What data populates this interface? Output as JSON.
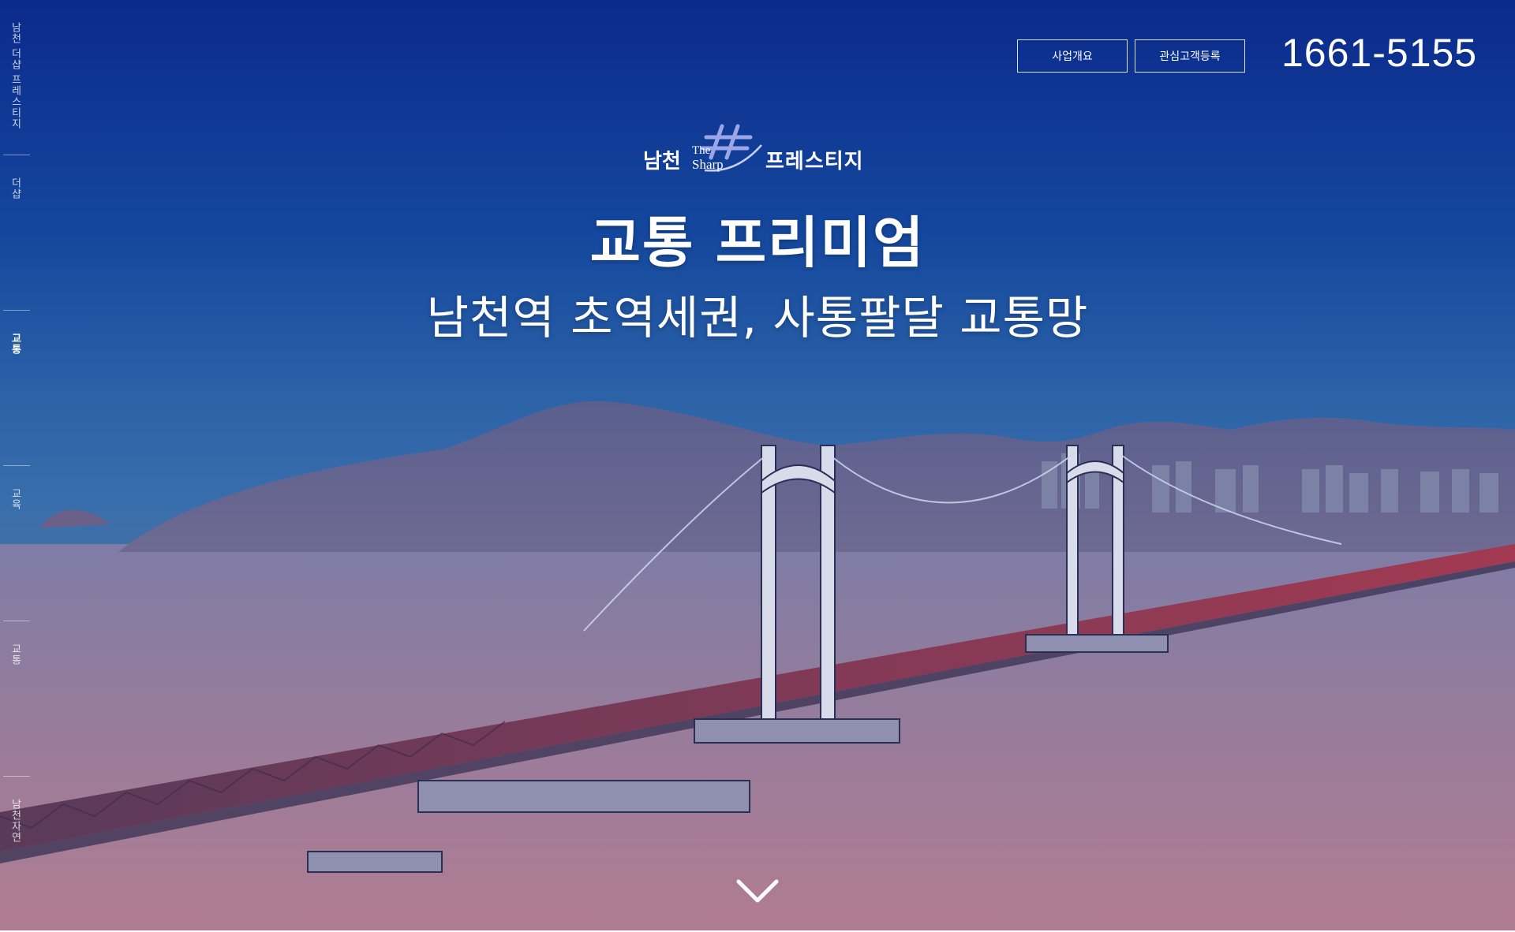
{
  "side_nav": {
    "items": [
      {
        "label": "남천 더샵 프레스티지",
        "active": false
      },
      {
        "label": "더샵",
        "active": false
      },
      {
        "label": "교통",
        "active": true
      },
      {
        "label": "교육",
        "active": false
      },
      {
        "label": "교통",
        "active": false
      },
      {
        "label": "남천자연",
        "active": false
      }
    ]
  },
  "header": {
    "overview_label": "사업개요",
    "register_label": "관심고객등록",
    "phone": "1661-5155"
  },
  "logo": {
    "left_text": "남천",
    "the_text": "The",
    "sharp_text": "Sharp",
    "right_text": "프레스티지"
  },
  "hero": {
    "title": "교통 프리미엄",
    "subtitle": "남천역 초역세권, 사통팔달 교통망"
  },
  "icons": {
    "scroll": "chevron-down-icon"
  },
  "colors": {
    "sky_top": "#0b2a8c",
    "sea": "#8c6f8c",
    "text": "#ffffff"
  }
}
